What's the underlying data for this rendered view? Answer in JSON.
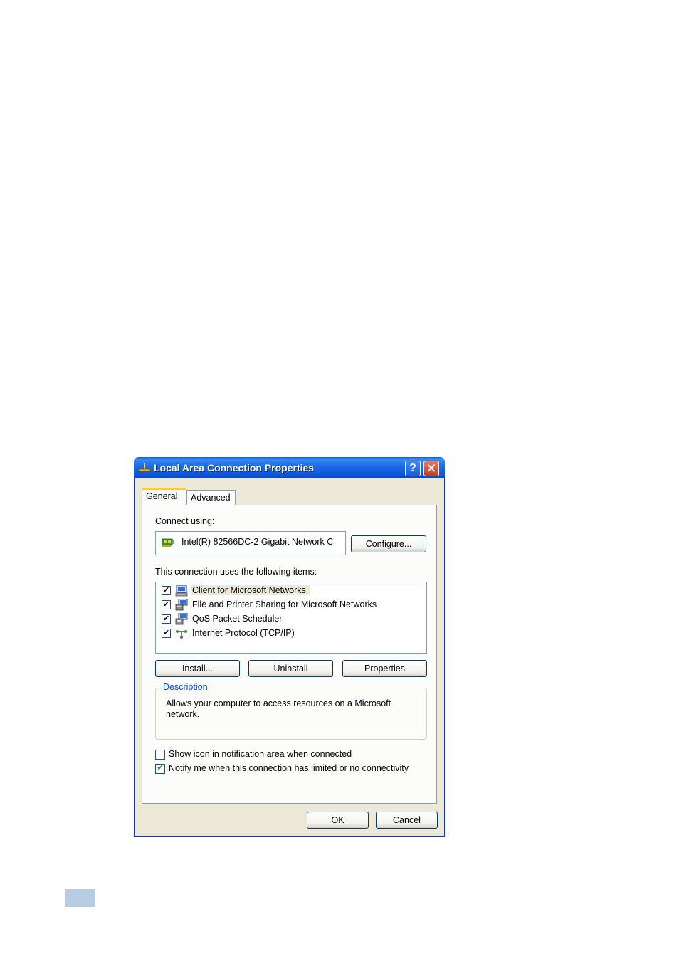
{
  "window": {
    "title": "Local Area Connection Properties",
    "help_label": "?",
    "close_label": "✕"
  },
  "tabs": [
    {
      "label": "General",
      "active": true
    },
    {
      "label": "Advanced",
      "active": false
    }
  ],
  "general": {
    "connect_using_label": "Connect using:",
    "adapter_name": "Intel(R) 82566DC-2 Gigabit Network C",
    "configure_label": "Configure...",
    "items_label": "This connection uses the following items:",
    "items": [
      {
        "label": "Client for Microsoft Networks",
        "checked": true,
        "icon": "network-client-icon"
      },
      {
        "label": "File and Printer Sharing for Microsoft Networks",
        "checked": true,
        "icon": "network-service-icon"
      },
      {
        "label": "QoS Packet Scheduler",
        "checked": true,
        "icon": "network-service-icon"
      },
      {
        "label": "Internet Protocol (TCP/IP)",
        "checked": true,
        "icon": "network-protocol-icon"
      }
    ],
    "install_label": "Install...",
    "uninstall_label": "Uninstall",
    "properties_label": "Properties",
    "description_legend": "Description",
    "description_text": "Allows your computer to access resources on a Microsoft network.",
    "show_icon_label": "Show icon in notification area when connected",
    "show_icon_checked": false,
    "notify_label": "Notify me when this connection has limited or no connectivity",
    "notify_checked": true
  },
  "footer": {
    "ok_label": "OK",
    "cancel_label": "Cancel"
  },
  "checkmark": "✔"
}
